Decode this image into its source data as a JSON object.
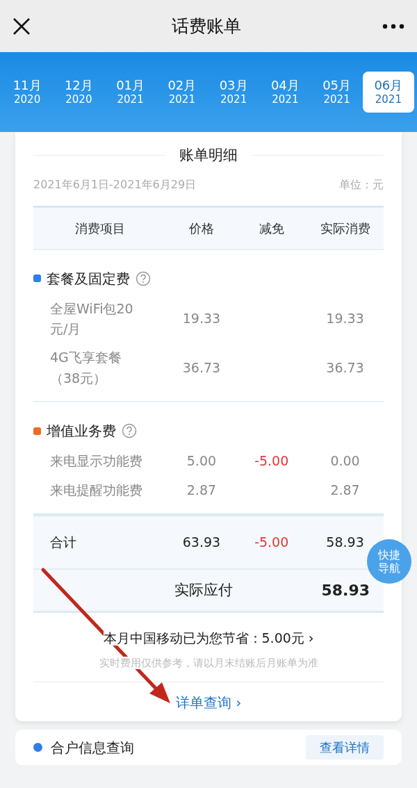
{
  "header": {
    "title": "话费账单"
  },
  "months": [
    {
      "month": "11月",
      "year": "2020",
      "selected": false
    },
    {
      "month": "12月",
      "year": "2020",
      "selected": false
    },
    {
      "month": "01月",
      "year": "2021",
      "selected": false
    },
    {
      "month": "02月",
      "year": "2021",
      "selected": false
    },
    {
      "month": "03月",
      "year": "2021",
      "selected": false
    },
    {
      "month": "04月",
      "year": "2021",
      "selected": false
    },
    {
      "month": "05月",
      "year": "2021",
      "selected": false
    },
    {
      "month": "06月",
      "year": "2021",
      "selected": true
    }
  ],
  "bill": {
    "title": "账单明细",
    "period": "2021年6月1日-2021年6月29日",
    "unit": "单位：元",
    "columns": [
      "消费项目",
      "价格",
      "减免",
      "实际消费"
    ],
    "sections": [
      {
        "name": "套餐及固定费",
        "color": "#2f7fe6",
        "items": [
          {
            "name": "全屋WiFi包20元/月",
            "price": "19.33",
            "actual": "19.33"
          },
          {
            "name": "4G飞享套餐（38元）",
            "price": "36.73",
            "actual": "36.73"
          }
        ]
      },
      {
        "name": "增值业务费",
        "color": "#f06a25",
        "items": [
          {
            "name": "来电显示功能费",
            "price": "5.00",
            "discount": "-5.00",
            "actual": "0.00"
          },
          {
            "name": "来电提醒功能费",
            "price": "2.87",
            "actual": "2.87"
          }
        ]
      }
    ],
    "total": {
      "label": "合计",
      "price": "63.93",
      "discount": "-5.00",
      "actual": "58.93"
    },
    "payable": {
      "label": "实际应付",
      "amount": "58.93"
    },
    "savings": "本月中国移动已为您节省：5.00元 ›",
    "note": "实时费用仅供参考，请以月末结账后月账单为准",
    "detail_link": "详单查询 ›"
  },
  "quick_nav": "快捷导航",
  "account": {
    "title": "合户信息查询",
    "color": "#2f7fe6",
    "button": "查看详情"
  }
}
